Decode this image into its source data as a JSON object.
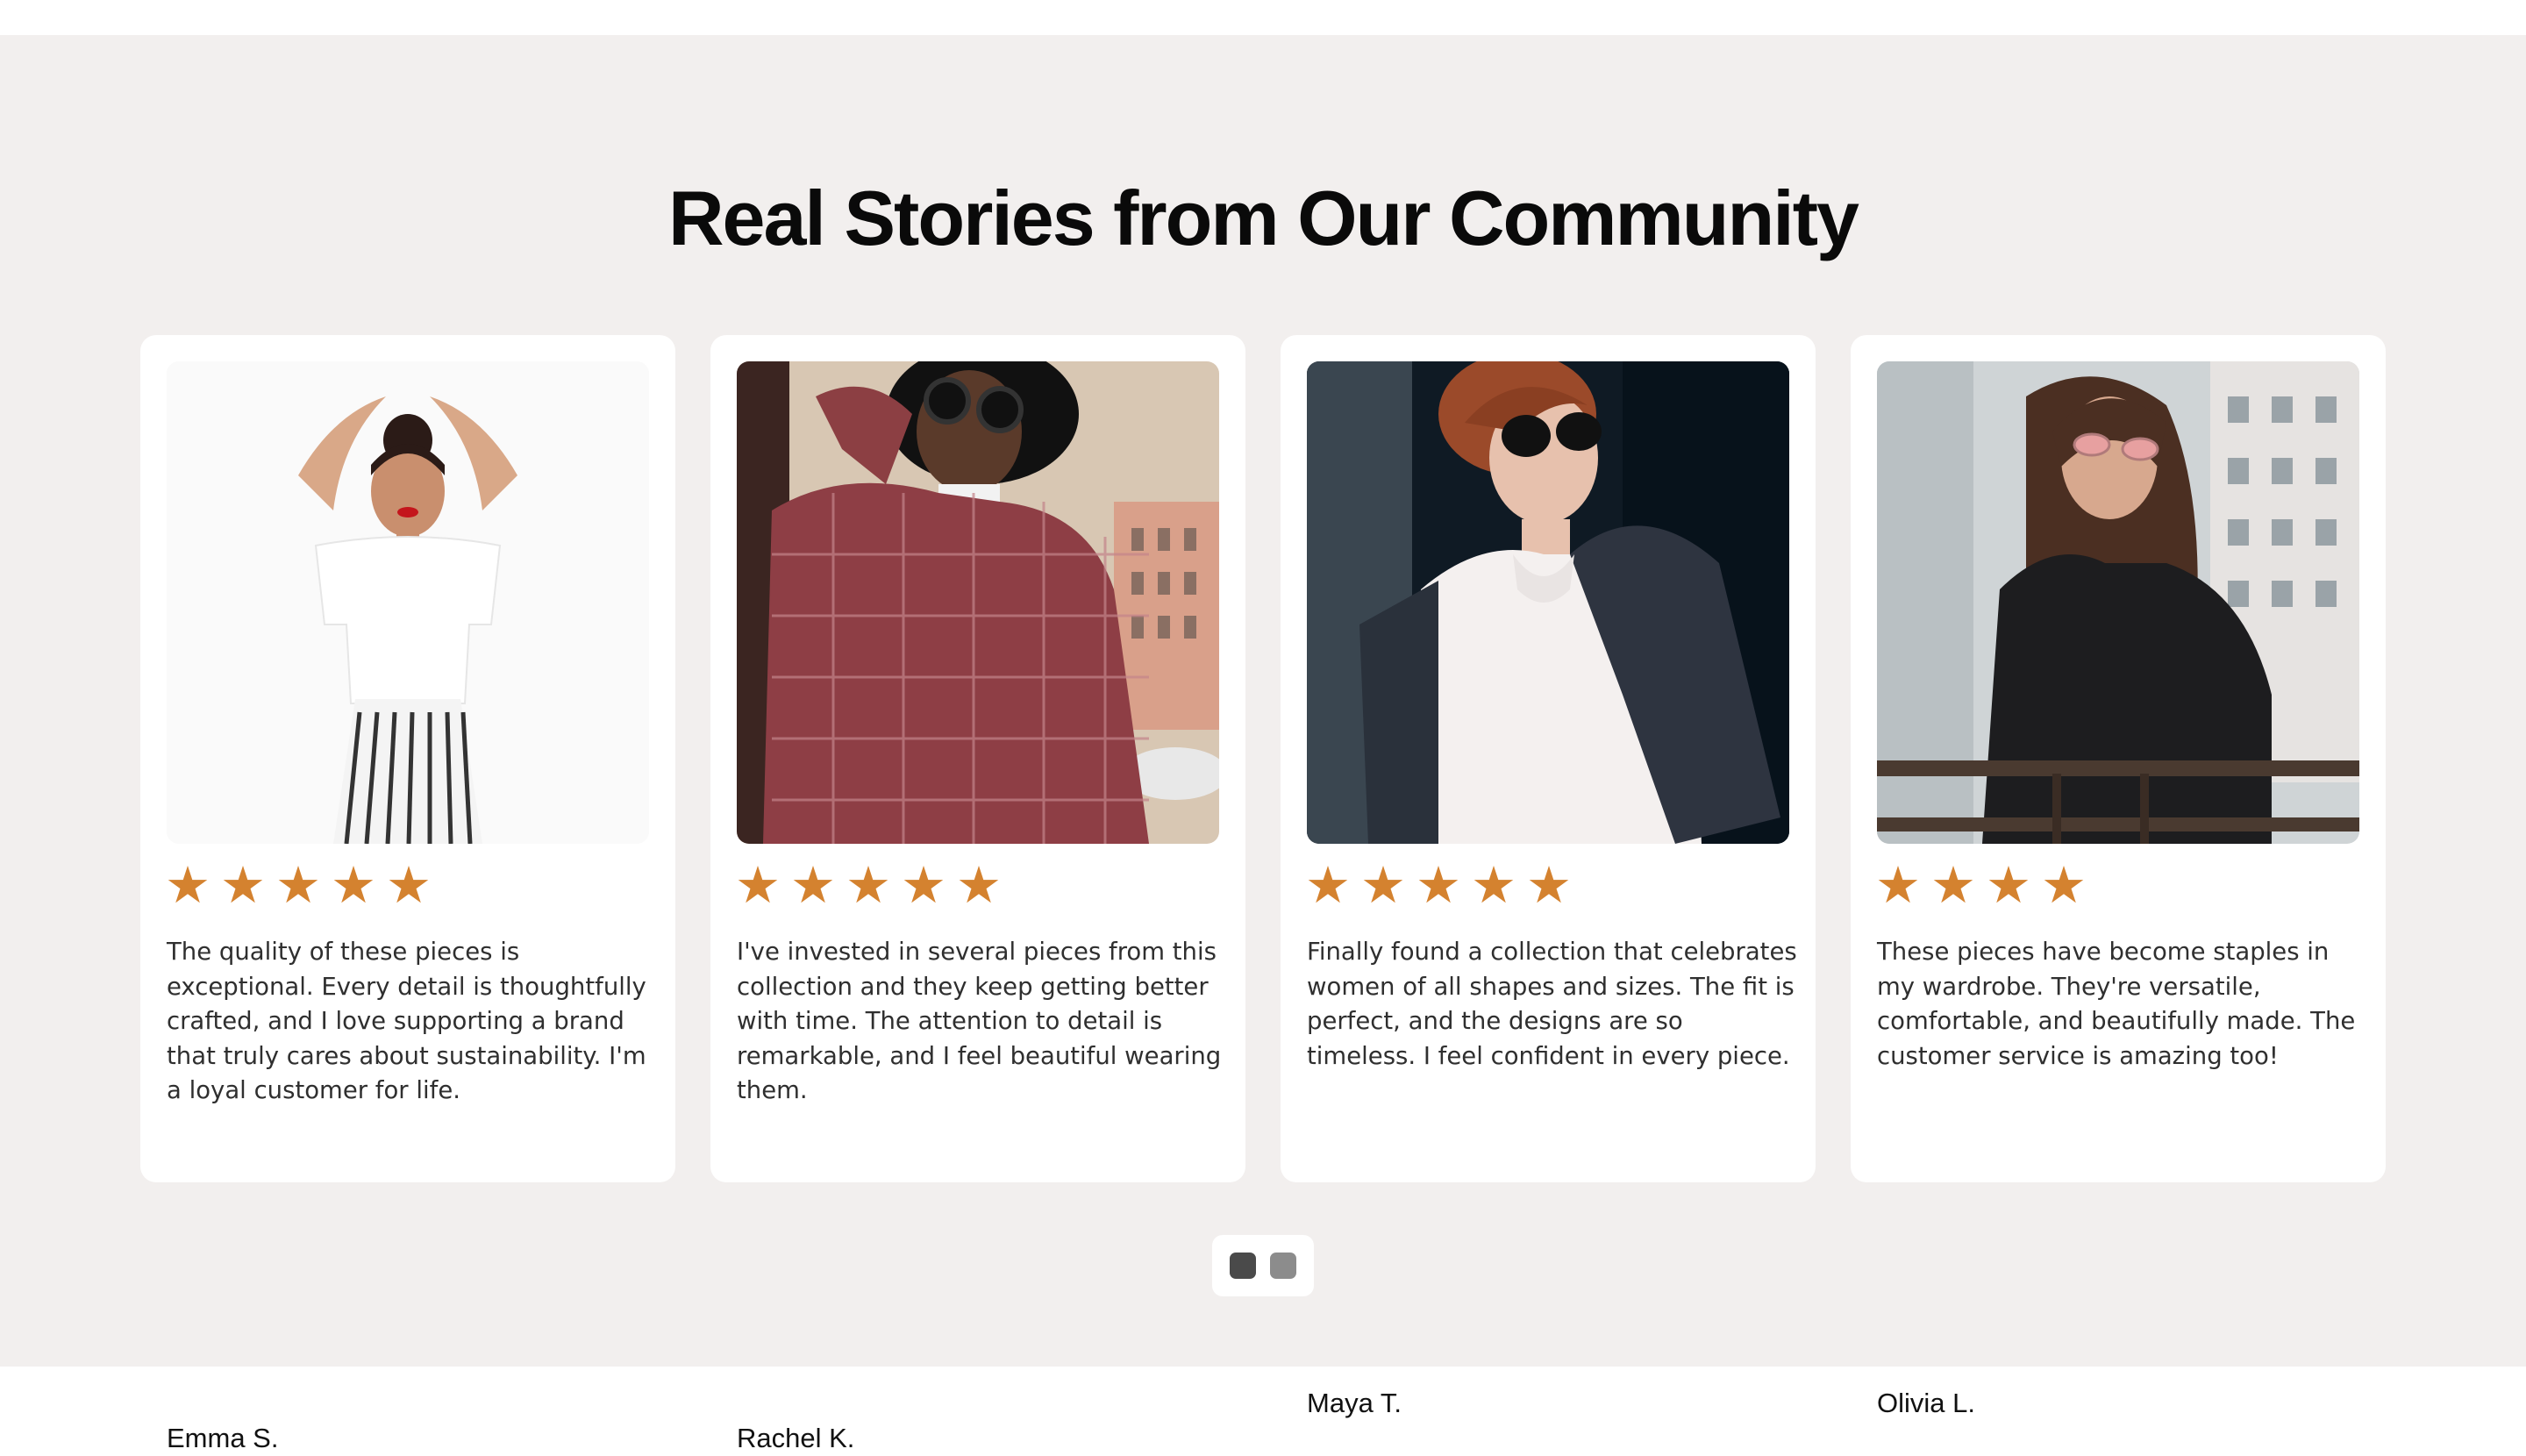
{
  "section": {
    "title": "Real Stories from Our Community"
  },
  "colors": {
    "background": "#f2efee",
    "card": "#ffffff",
    "star": "#d4822f",
    "dot_active": "#4a4a4a",
    "dot_inactive": "#8c8c8c"
  },
  "testimonials": [
    {
      "photo_icon": "woman-white-tshirt-photo",
      "rating": 5,
      "quote": "The quality of these pieces is exceptional. Every detail is thoughtfully crafted, and I love supporting a brand that truly cares about sustainability. I'm a loyal customer for life.",
      "author": "Emma S."
    },
    {
      "photo_icon": "woman-plaid-suit-photo",
      "rating": 5,
      "quote": "I've invested in several pieces from this collection and they keep getting better with time. The attention to detail is remarkable, and I feel beautiful wearing them.",
      "author": "Rachel K."
    },
    {
      "photo_icon": "woman-sunglasses-coat-photo",
      "rating": 5,
      "quote": "Finally found a collection that celebrates women of all shapes and sizes. The fit is perfect, and the designs are so timeless. I feel confident in every piece.",
      "author": "Maya T."
    },
    {
      "photo_icon": "woman-black-jacket-photo",
      "rating": 4,
      "quote": "These pieces have become staples in my wardrobe. They're versatile, comfortable, and beautifully made. The customer service is amazing too!",
      "author": "Olivia L."
    }
  ],
  "pagination": {
    "pages": 2,
    "current": 1
  }
}
